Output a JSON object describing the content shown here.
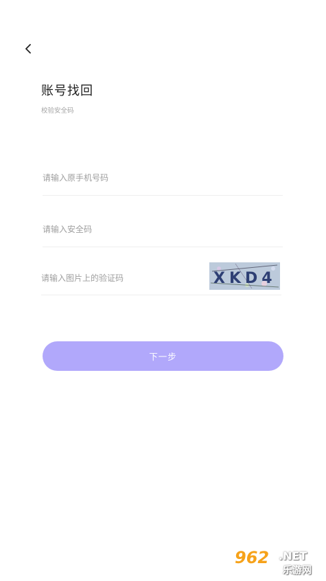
{
  "header": {
    "title": "账号找回",
    "subtitle": "校验安全码"
  },
  "form": {
    "phone_placeholder": "请输入原手机号码",
    "security_placeholder": "请输入安全码",
    "captcha_placeholder": "请输入图片上的验证码",
    "captcha_text": "XKD4"
  },
  "actions": {
    "next_label": "下一步"
  },
  "watermark": {
    "number": "962",
    "suffix": ".NET",
    "site": "乐游网"
  },
  "colors": {
    "accent": "#b1a8fb",
    "title": "#1f1f1f",
    "placeholder": "#9e9e9e",
    "divider": "#eeeeee"
  },
  "icons": {
    "back": "chevron-left-icon"
  }
}
